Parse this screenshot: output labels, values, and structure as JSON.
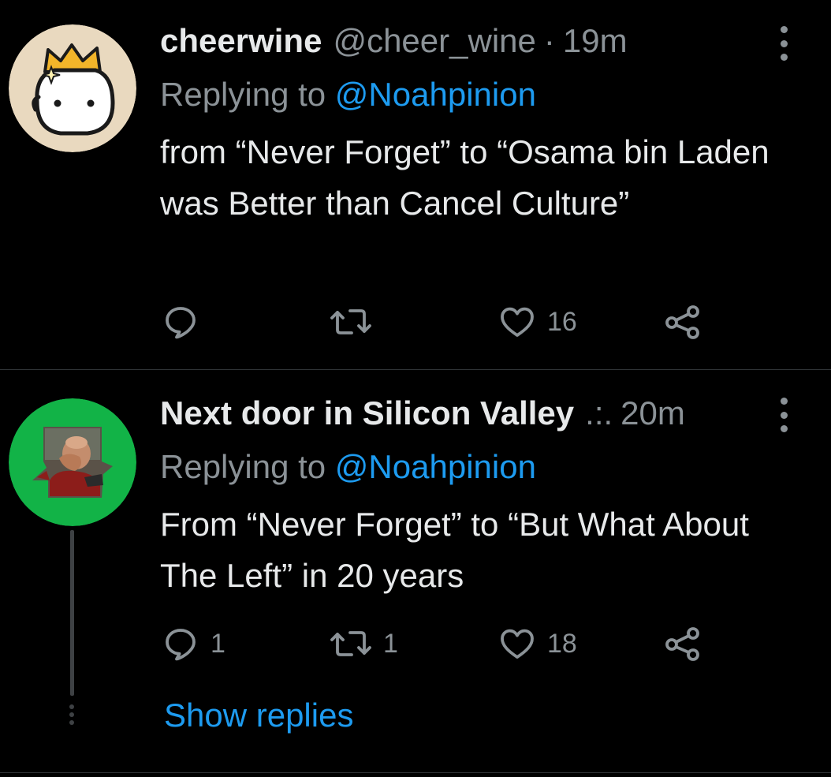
{
  "tweets": [
    {
      "display_name": "cheerwine",
      "handle": "@cheer_wine",
      "separator": "·",
      "time": "19m",
      "replying_label": "Replying to ",
      "replying_to": "@Noahpinion",
      "text": "from “Never Forget” to “Osama bin Laden was Better than Cancel Culture”",
      "reply_count": "",
      "retweet_count": "",
      "like_count": "16",
      "avatar_icon": "crown-blob-avatar-icon"
    },
    {
      "display_name": "Next door in Silicon Valley",
      "handle": ".:.",
      "separator": "",
      "time": "20m",
      "replying_label": "Replying to ",
      "replying_to": "@Noahpinion",
      "text": "From “Never Forget” to “But What About The Left” in 20 years",
      "reply_count": "1",
      "retweet_count": "1",
      "like_count": "18",
      "avatar_icon": "facepalm-avatar-icon"
    }
  ],
  "show_replies_label": "Show replies",
  "colors": {
    "background": "#000000",
    "text": "#e7e9ea",
    "muted": "#8b9297",
    "accent": "#1d9bf0",
    "divider": "#2f3336"
  },
  "icons": {
    "reply": "reply-icon",
    "retweet": "retweet-icon",
    "like": "heart-icon",
    "share": "share-icon",
    "more": "more-options-icon"
  }
}
